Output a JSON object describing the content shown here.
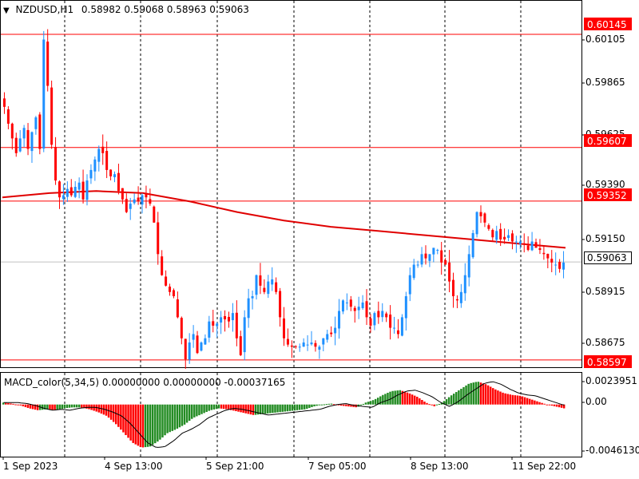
{
  "header": {
    "dropdown_icon": "triangle-down-icon",
    "symbol": "NZDUSD,H1",
    "ohlc": "0.58982 0.59068 0.58963 0.59063"
  },
  "price_axis": {
    "ticks": [
      "0.60105",
      "0.59865",
      "0.59625",
      "0.59390",
      "0.59150",
      "0.58915",
      "0.58675"
    ],
    "range": [
      0.5857,
      0.6027
    ]
  },
  "levels": [
    {
      "label": "0.60145",
      "value": 0.60145
    },
    {
      "label": "0.59607",
      "value": 0.59607
    },
    {
      "label": "0.59352",
      "value": 0.59352
    },
    {
      "label": "0.58597",
      "value": 0.58597
    }
  ],
  "current_price": {
    "label": "0.59063",
    "value": 0.59063
  },
  "macd": {
    "title": "MACD_color(5,34,5) 0.00000000 0.00000000 -0.00037165",
    "ticks": [
      "0.0023951",
      "0.00",
      "-0.0046130"
    ],
    "range": [
      -0.004613,
      0.0023951
    ]
  },
  "time_axis": {
    "labels": [
      "1 Sep 2023",
      "4 Sep 13:00",
      "5 Sep 21:00",
      "7 Sep 05:00",
      "8 Sep 13:00",
      "11 Sep 22:00"
    ]
  },
  "colors": {
    "bull": "#1e90ff",
    "bear": "#ff0000",
    "ma": "#e00000",
    "level": "#ff0000",
    "macd_up": "#228b22",
    "macd_down": "#ff0000",
    "grid": "#000000"
  },
  "chart_data": [
    {
      "type": "candlestick",
      "title": "NZDUSD,H1",
      "ylim": [
        0.5857,
        0.6027
      ],
      "x_labels": [
        "1 Sep 2023",
        "4 Sep 13:00",
        "5 Sep 21:00",
        "7 Sep 05:00",
        "8 Sep 13:00",
        "11 Sep 22:00"
      ],
      "close_path": [
        0.598,
        0.5972,
        0.5965,
        0.5958,
        0.5965,
        0.597,
        0.596,
        0.5968,
        0.5975,
        0.596,
        0.6012,
        0.599,
        0.5962,
        0.5945,
        0.5937,
        0.5938,
        0.5941,
        0.5938,
        0.5942,
        0.5944,
        0.5936,
        0.5945,
        0.595,
        0.5955,
        0.596,
        0.5958,
        0.595,
        0.5947,
        0.5948,
        0.594,
        0.5936,
        0.593,
        0.5934,
        0.5936,
        0.5935,
        0.5938,
        0.5937,
        0.5934,
        0.5925,
        0.591,
        0.59,
        0.5895,
        0.5892,
        0.589,
        0.588,
        0.587,
        0.586,
        0.5868,
        0.5872,
        0.5863,
        0.5868,
        0.587,
        0.5878,
        0.5876,
        0.5877,
        0.588,
        0.5879,
        0.5878,
        0.5882,
        0.587,
        0.5862,
        0.588,
        0.5889,
        0.589,
        0.59,
        0.5895,
        0.5892,
        0.5897,
        0.5898,
        0.5892,
        0.588,
        0.587,
        0.5867,
        0.5866,
        0.5866,
        0.5866,
        0.5868,
        0.5867,
        0.5868,
        0.5866,
        0.5866,
        0.587,
        0.5872,
        0.5872,
        0.5875,
        0.5883,
        0.5888,
        0.5887,
        0.5885,
        0.5883,
        0.5885,
        0.5887,
        0.588,
        0.5876,
        0.5882,
        0.588,
        0.5883,
        0.588,
        0.5875,
        0.5875,
        0.5872,
        0.588,
        0.589,
        0.59,
        0.5905,
        0.5905,
        0.591,
        0.5908,
        0.591,
        0.5913,
        0.5912,
        0.5906,
        0.5905,
        0.5897,
        0.589,
        0.5888,
        0.5892,
        0.59,
        0.591,
        0.592,
        0.593,
        0.5928,
        0.5925,
        0.5922,
        0.5918,
        0.5921,
        0.5917,
        0.5917,
        0.5919,
        0.5916,
        0.5916,
        0.5916,
        0.5915,
        0.5912,
        0.5916,
        0.5913,
        0.5912,
        0.591,
        0.5908,
        0.5906,
        0.5905,
        0.5903,
        0.5906
      ],
      "moving_average": [
        0.5937,
        0.5939,
        0.594,
        0.5939,
        0.5935,
        0.593,
        0.5926,
        0.5923,
        0.5921,
        0.5919,
        0.5917,
        0.5915,
        0.5913
      ]
    },
    {
      "type": "bar",
      "title": "MACD_color(5,34,5) 0.00000000 0.00000000 -0.00037165",
      "ylim": [
        -0.004613,
        0.0023951
      ],
      "values_path": [
        0.0002,
        0.0001,
        -0.0001,
        -0.0004,
        -0.0006,
        -0.0005,
        -0.0006,
        -0.0004,
        -0.0003,
        -0.0003,
        -0.0005,
        -0.0008,
        -0.0012,
        -0.002,
        -0.003,
        -0.004,
        -0.0045,
        -0.0044,
        -0.0038,
        -0.003,
        -0.0026,
        -0.0021,
        -0.0014,
        -0.001,
        -0.0006,
        -0.0004,
        -0.0005,
        -0.0007,
        -0.0009,
        -0.0011,
        -0.001,
        -0.0009,
        -0.0008,
        -0.0007,
        -0.0006,
        -0.0005,
        -0.0002,
        0.0,
        0.0001,
        -0.0001,
        -0.0002,
        -0.0003,
        0.0002,
        0.0005,
        0.001,
        0.0014,
        0.0015,
        0.0012,
        0.0008,
        0.0002,
        -0.0002,
        0.0003,
        0.001,
        0.0016,
        0.0022,
        0.0024,
        0.0021,
        0.0016,
        0.0012,
        0.001,
        0.0009,
        0.0006,
        0.0003,
        0.0,
        -0.0002,
        -0.0004
      ]
    }
  ]
}
